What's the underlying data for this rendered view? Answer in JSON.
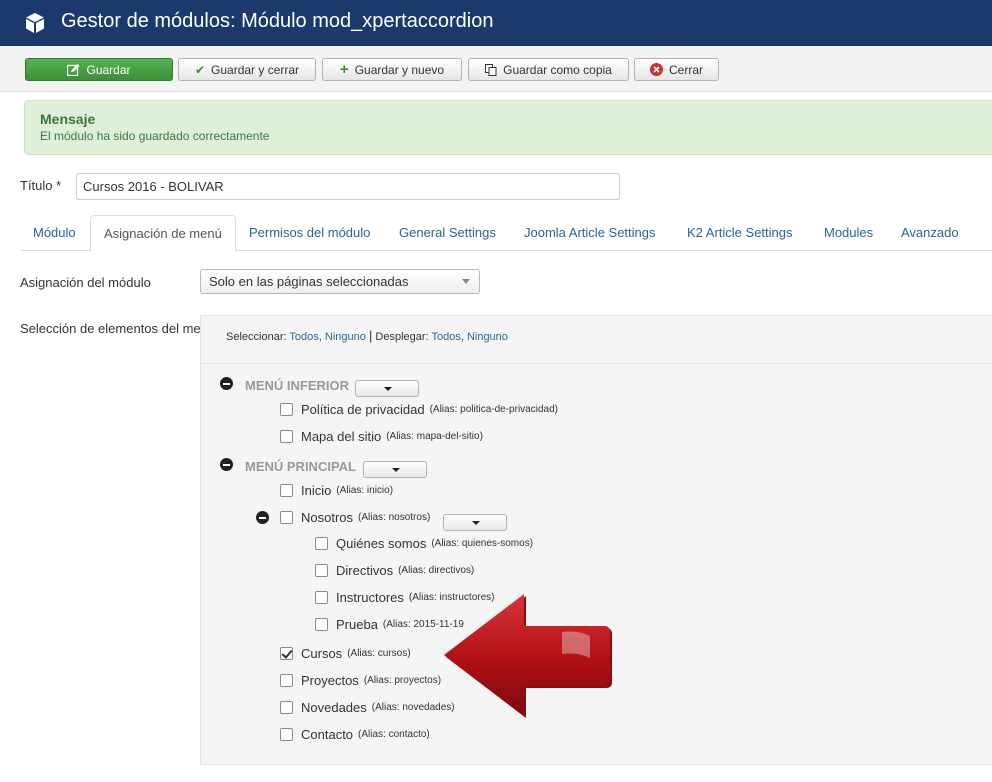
{
  "header": {
    "title": "Gestor de módulos: Módulo mod_xpertaccordion",
    "icon": "cube-icon"
  },
  "toolbar": {
    "save": "Guardar",
    "save_close": "Guardar y cerrar",
    "save_new": "Guardar y nuevo",
    "save_copy": "Guardar como copia",
    "close": "Cerrar"
  },
  "alert": {
    "heading": "Mensaje",
    "message": "El módulo ha sido guardado correctamente"
  },
  "form": {
    "title_label": "Título *",
    "title_value": "Cursos 2016 - BOLIVAR"
  },
  "tabs": [
    "Módulo",
    "Asignación de menú",
    "Permisos del módulo",
    "General Settings",
    "Joomla Article Settings",
    "K2 Article Settings",
    "Modules",
    "Avanzado"
  ],
  "active_tab": "Asignación de menú",
  "assignment": {
    "label": "Asignación del módulo",
    "value": "Solo en las páginas seleccionadas"
  },
  "selection": {
    "label": "Selección de elementos del menú:",
    "select_label": "Seleccionar:",
    "all": "Todos",
    "none": "Ninguno",
    "sep": "|",
    "expand_label": "Desplegar:",
    "all2": "Todos",
    "none2": "Ninguno"
  },
  "menus": [
    {
      "title": "MENÚ INFERIOR",
      "items": [
        {
          "name": "Política de privacidad",
          "alias": "(Alias: politica-de-privacidad)",
          "checked": false
        },
        {
          "name": "Mapa del sitio",
          "alias": "(Alias: mapa-del-sitio)",
          "checked": false
        }
      ]
    },
    {
      "title": "MENÚ PRINCIPAL",
      "items": [
        {
          "name": "Inicio",
          "alias": "(Alias: inicio)",
          "checked": false
        },
        {
          "name": "Nosotros",
          "alias": "(Alias: nosotros)",
          "checked": false
        },
        {
          "name": "Quiénes somos",
          "alias": "(Alias: quienes-somos)",
          "checked": false
        },
        {
          "name": "Directivos",
          "alias": "(Alias: directivos)",
          "checked": false
        },
        {
          "name": "Instructores",
          "alias": "(Alias: instructores)",
          "checked": false
        },
        {
          "name": "Prueba",
          "alias": "(Alias: 2015-11-19",
          "checked": false
        },
        {
          "name": "Cursos",
          "alias": "(Alias: cursos)",
          "checked": true
        },
        {
          "name": "Proyectos",
          "alias": "(Alias: proyectos)",
          "checked": false
        },
        {
          "name": "Novedades",
          "alias": "(Alias: novedades)",
          "checked": false
        },
        {
          "name": "Contacto",
          "alias": "(Alias: contacto)",
          "checked": false
        }
      ]
    }
  ],
  "colors": {
    "header": "#1b3a6b",
    "save": "#4aa544",
    "alert_bg": "#dff0d8",
    "alert_text": "#3c763d",
    "link": "#2a6496",
    "arrow": "#b00f14"
  }
}
